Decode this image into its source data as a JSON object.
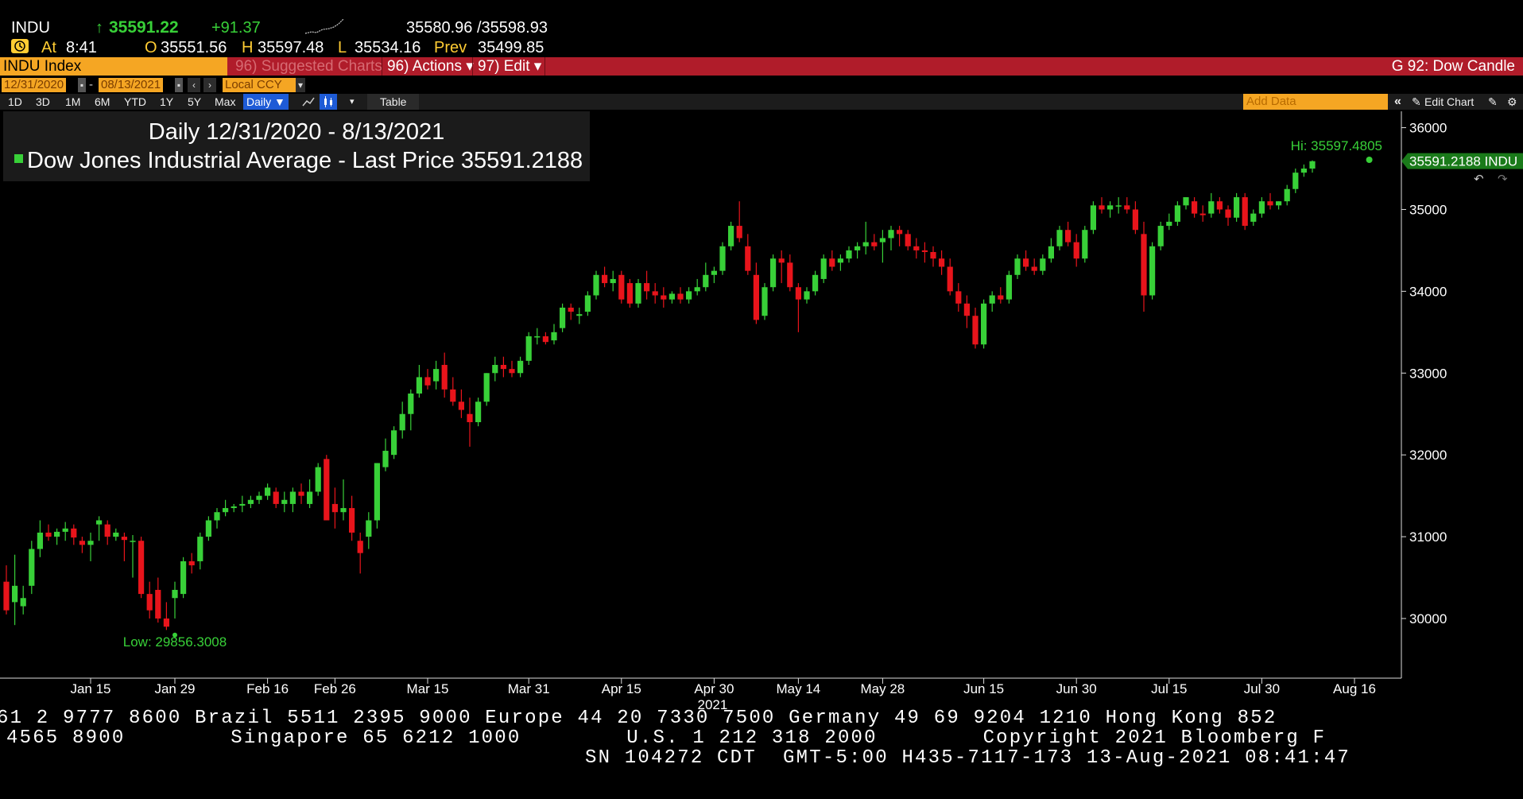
{
  "quote": {
    "ticker": "INDU",
    "arrow": "↑",
    "last": "35591.22",
    "change": "+91.37",
    "bid_ask": "35580.96 /35598.93",
    "at_label": "At",
    "time": "8:41",
    "open_label": "O",
    "open": "35551.56",
    "high_label": "H",
    "high": "35597.48",
    "low_label": "L",
    "low": "35534.16",
    "prev_label": "Prev",
    "prev": "35499.85"
  },
  "command_bar": {
    "security": "INDU Index",
    "suggested": "96) Suggested Charts",
    "actions": "96) Actions ▾",
    "edit": "97) Edit ▾",
    "chart_name": "G 92: Dow Candle"
  },
  "date_bar": {
    "start": "12/31/2020",
    "separator": "-",
    "end": "08/13/2021",
    "currency": "Local CCY"
  },
  "range_bar": {
    "ranges": [
      "1D",
      "3D",
      "1M",
      "6M",
      "YTD",
      "1Y",
      "5Y",
      "Max"
    ],
    "period": "Daily ▼",
    "table": "Table",
    "add_data_placeholder": "Add Data",
    "edit_chart": "Edit Chart"
  },
  "legend": {
    "title": "Daily 12/31/2020 - 8/13/2021",
    "series": "Dow Jones Industrial Average - Last Price",
    "value": "35591.2188"
  },
  "chart_data": {
    "type": "candlestick",
    "title": "Daily 12/31/2020 - 8/13/2021",
    "series_name": "Dow Jones Industrial Average - Last Price",
    "ylim": [
      29300,
      36200
    ],
    "y_ticks": [
      30000,
      31000,
      32000,
      33000,
      34000,
      35000,
      36000
    ],
    "y_tick_labels": [
      "30000",
      "31000",
      "32000",
      "33000",
      "34000",
      "35000",
      "36000"
    ],
    "x_labels": [
      "Jan 15",
      "Jan 29",
      "Feb 16",
      "Feb 26",
      "Mar 15",
      "Mar 31",
      "Apr 15",
      "Apr 30",
      "May 14",
      "May 28",
      "Jun 15",
      "Jun 30",
      "Jul 15",
      "Jul 30",
      "Aug 16"
    ],
    "x_label_index": [
      10,
      20,
      31,
      39,
      50,
      62,
      73,
      84,
      94,
      104,
      116,
      127,
      138,
      149,
      160
    ],
    "year_label": "2021",
    "year_label_index": 84,
    "low_label": "Low: 29856.3008",
    "low_index": 20,
    "low_value": 29856.3008,
    "high_label": "Hi: 35597.4805",
    "high_index": 161,
    "high_value": 35597.4805,
    "last_label": "35591.2188 INDU",
    "last_value": 35591.2188,
    "up_color": "#38d038",
    "down_color": "#e8141b",
    "candles": [
      [
        30450,
        30650,
        30050,
        30100
      ],
      [
        30200,
        30780,
        29920,
        30400
      ],
      [
        30150,
        30400,
        30050,
        30250
      ],
      [
        30400,
        30950,
        30300,
        30850
      ],
      [
        30850,
        31200,
        30750,
        31050
      ],
      [
        31050,
        31150,
        30950,
        31000
      ],
      [
        31000,
        31100,
        30900,
        31060
      ],
      [
        31060,
        31180,
        30950,
        31100
      ],
      [
        31100,
        31150,
        30900,
        30990
      ],
      [
        30950,
        31000,
        30800,
        30900
      ],
      [
        30900,
        31050,
        30700,
        30950
      ],
      [
        31150,
        31250,
        30950,
        31200
      ],
      [
        31150,
        31200,
        30900,
        31000
      ],
      [
        31000,
        31100,
        30950,
        31050
      ],
      [
        31000,
        31050,
        30700,
        30960
      ],
      [
        30950,
        31020,
        30500,
        30950
      ],
      [
        30950,
        31000,
        30250,
        30300
      ],
      [
        30300,
        30450,
        30000,
        30100
      ],
      [
        30350,
        30500,
        29950,
        30000
      ],
      [
        30000,
        30200,
        29860,
        29900
      ],
      [
        30250,
        30450,
        30000,
        30350
      ],
      [
        30300,
        30750,
        30250,
        30700
      ],
      [
        30700,
        30800,
        30550,
        30650
      ],
      [
        30700,
        31050,
        30600,
        31000
      ],
      [
        31000,
        31250,
        30950,
        31200
      ],
      [
        31200,
        31350,
        31100,
        31300
      ],
      [
        31300,
        31450,
        31250,
        31350
      ],
      [
        31350,
        31400,
        31300,
        31370
      ],
      [
        31380,
        31500,
        31300,
        31400
      ],
      [
        31400,
        31500,
        31350,
        31450
      ],
      [
        31450,
        31550,
        31400,
        31500
      ],
      [
        31500,
        31650,
        31450,
        31600
      ],
      [
        31550,
        31600,
        31350,
        31400
      ],
      [
        31400,
        31550,
        31300,
        31450
      ],
      [
        31400,
        31600,
        31300,
        31550
      ],
      [
        31550,
        31650,
        31400,
        31500
      ],
      [
        31400,
        31700,
        31350,
        31550
      ],
      [
        31550,
        31900,
        31500,
        31850
      ],
      [
        31950,
        32000,
        31200,
        31200
      ],
      [
        31400,
        31600,
        31100,
        31300
      ],
      [
        31300,
        31700,
        31200,
        31350
      ],
      [
        31350,
        31500,
        30950,
        31050
      ],
      [
        30950,
        31050,
        30550,
        30800
      ],
      [
        31000,
        31300,
        30850,
        31200
      ],
      [
        31200,
        31900,
        31100,
        31900
      ],
      [
        31850,
        32200,
        31800,
        32050
      ],
      [
        32000,
        32350,
        31950,
        32300
      ],
      [
        32300,
        32650,
        32200,
        32500
      ],
      [
        32500,
        32800,
        32300,
        32750
      ],
      [
        32750,
        33100,
        32700,
        32950
      ],
      [
        32950,
        33050,
        32800,
        32850
      ],
      [
        32900,
        33150,
        32800,
        33050
      ],
      [
        33100,
        33250,
        32700,
        32800
      ],
      [
        32800,
        32950,
        32600,
        32650
      ],
      [
        32650,
        32800,
        32450,
        32550
      ],
      [
        32500,
        32700,
        32100,
        32400
      ],
      [
        32400,
        32700,
        32350,
        32650
      ],
      [
        32650,
        33000,
        32600,
        33000
      ],
      [
        33000,
        33200,
        32900,
        33100
      ],
      [
        33100,
        33200,
        32950,
        33050
      ],
      [
        33050,
        33150,
        32950,
        33000
      ],
      [
        33000,
        33200,
        32950,
        33150
      ],
      [
        33150,
        33500,
        33100,
        33450
      ],
      [
        33450,
        33550,
        33350,
        33450
      ],
      [
        33450,
        33500,
        33350,
        33380
      ],
      [
        33400,
        33600,
        33350,
        33500
      ],
      [
        33550,
        33850,
        33500,
        33800
      ],
      [
        33800,
        33850,
        33650,
        33750
      ],
      [
        33700,
        33800,
        33600,
        33720
      ],
      [
        33750,
        34000,
        33700,
        33950
      ],
      [
        33950,
        34250,
        33900,
        34200
      ],
      [
        34200,
        34300,
        34050,
        34100
      ],
      [
        34100,
        34250,
        34000,
        34150
      ],
      [
        34200,
        34250,
        33850,
        33900
      ],
      [
        34100,
        34150,
        33800,
        33850
      ],
      [
        33850,
        34150,
        33800,
        34100
      ],
      [
        34100,
        34250,
        33900,
        34000
      ],
      [
        34000,
        34100,
        33850,
        33950
      ],
      [
        33950,
        34050,
        33800,
        33900
      ],
      [
        33900,
        34000,
        33850,
        33970
      ],
      [
        33970,
        34050,
        33850,
        33900
      ],
      [
        33900,
        34050,
        33850,
        34000
      ],
      [
        34000,
        34150,
        33950,
        34050
      ],
      [
        34050,
        34350,
        34000,
        34200
      ],
      [
        34200,
        34300,
        34100,
        34250
      ],
      [
        34250,
        34600,
        34200,
        34550
      ],
      [
        34550,
        34850,
        34500,
        34800
      ],
      [
        34800,
        35100,
        34600,
        34650
      ],
      [
        34550,
        34700,
        34200,
        34250
      ],
      [
        34200,
        34350,
        33600,
        33650
      ],
      [
        33700,
        34100,
        33650,
        34050
      ],
      [
        34050,
        34450,
        34000,
        34400
      ],
      [
        34400,
        34500,
        34100,
        34350
      ],
      [
        34350,
        34450,
        34000,
        34050
      ],
      [
        34050,
        34100,
        33500,
        33900
      ],
      [
        33900,
        34050,
        33850,
        34000
      ],
      [
        34000,
        34250,
        33950,
        34200
      ],
      [
        34150,
        34450,
        34100,
        34400
      ],
      [
        34400,
        34500,
        34250,
        34300
      ],
      [
        34350,
        34450,
        34250,
        34400
      ],
      [
        34400,
        34550,
        34350,
        34500
      ],
      [
        34500,
        34600,
        34400,
        34550
      ],
      [
        34550,
        34850,
        34450,
        34600
      ],
      [
        34600,
        34700,
        34500,
        34550
      ],
      [
        34600,
        34750,
        34350,
        34650
      ],
      [
        34650,
        34800,
        34500,
        34750
      ],
      [
        34750,
        34800,
        34550,
        34700
      ],
      [
        34700,
        34750,
        34500,
        34550
      ],
      [
        34550,
        34650,
        34400,
        34500
      ],
      [
        34500,
        34600,
        34350,
        34480
      ],
      [
        34480,
        34550,
        34300,
        34400
      ],
      [
        34400,
        34500,
        34200,
        34300
      ],
      [
        34300,
        34400,
        33950,
        34000
      ],
      [
        34000,
        34100,
        33750,
        33850
      ],
      [
        33850,
        33950,
        33550,
        33700
      ],
      [
        33700,
        33800,
        33300,
        33350
      ],
      [
        33350,
        33900,
        33300,
        33850
      ],
      [
        33850,
        34000,
        33750,
        33950
      ],
      [
        33950,
        34050,
        33850,
        33900
      ],
      [
        33900,
        34250,
        33850,
        34200
      ],
      [
        34200,
        34450,
        34150,
        34400
      ],
      [
        34400,
        34500,
        34250,
        34300
      ],
      [
        34300,
        34400,
        34200,
        34250
      ],
      [
        34250,
        34450,
        34200,
        34400
      ],
      [
        34400,
        34650,
        34350,
        34550
      ],
      [
        34550,
        34800,
        34500,
        34750
      ],
      [
        34750,
        34850,
        34550,
        34600
      ],
      [
        34600,
        34700,
        34300,
        34400
      ],
      [
        34400,
        34800,
        34350,
        34750
      ],
      [
        34750,
        35100,
        34700,
        35050
      ],
      [
        35050,
        35150,
        34950,
        35000
      ],
      [
        35000,
        35100,
        34900,
        35050
      ],
      [
        35050,
        35150,
        34950,
        35050
      ],
      [
        35050,
        35150,
        34950,
        35000
      ],
      [
        35000,
        35100,
        34700,
        34750
      ],
      [
        34700,
        34850,
        33750,
        33950
      ],
      [
        33950,
        34600,
        33900,
        34550
      ],
      [
        34550,
        34850,
        34500,
        34800
      ],
      [
        34800,
        34950,
        34750,
        34850
      ],
      [
        34850,
        35100,
        34800,
        35050
      ],
      [
        35050,
        35150,
        35000,
        35150
      ],
      [
        35100,
        35150,
        34900,
        34950
      ],
      [
        34950,
        35050,
        34850,
        34930
      ],
      [
        34950,
        35200,
        34900,
        35100
      ],
      [
        35100,
        35150,
        34950,
        35000
      ],
      [
        35000,
        35050,
        34800,
        34900
      ],
      [
        34900,
        35200,
        34850,
        35150
      ],
      [
        35150,
        35200,
        34750,
        34800
      ],
      [
        34850,
        35000,
        34800,
        34950
      ],
      [
        34950,
        35150,
        34900,
        35100
      ],
      [
        35100,
        35200,
        35000,
        35050
      ],
      [
        35050,
        35100,
        35000,
        35100
      ],
      [
        35100,
        35300,
        35050,
        35250
      ],
      [
        35250,
        35500,
        35200,
        35450
      ],
      [
        35450,
        35550,
        35400,
        35500
      ],
      [
        35500,
        35600,
        35450,
        35590
      ]
    ]
  },
  "ticker_strip": {
    "line1": "61 2 9777 8600 Brazil 5511 2395 9000 Europe 44 20 7330 7500 Germany 49 69 9204 1210 Hong Kong 852",
    "line2": "4565 8900        Singapore 65 6212 1000        U.S. 1 212 318 2000        Copyright 2021 Bloomberg F",
    "line3": "SN 104272 CDT  GMT-5:00 H435-7117-173 13-Aug-2021 08:41:47"
  },
  "colors": {
    "accent_orange": "#f5a623",
    "command_red": "#b01c2a",
    "up_green": "#38d038",
    "down_red": "#e8141b"
  }
}
